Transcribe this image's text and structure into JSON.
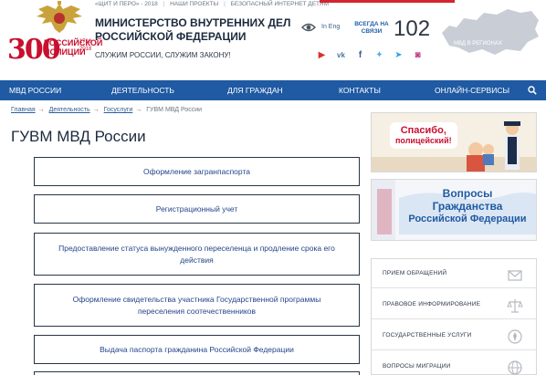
{
  "header": {
    "anniversary_number": "300",
    "anniversary_line1": "РОССИЙСКОЙ",
    "anniversary_line2": "ПОЛИЦИИ",
    "anniversary_years": "1718 2018",
    "top_links": [
      "«ЩИТ И ПЕРО» - 2018",
      "НАШИ ПРОЕКТЫ",
      "БЕЗОПАСНЫЙ ИНТЕРНЕТ ДЕТЯМ"
    ],
    "ministry_title": "МИНИСТЕРСТВО ВНУТРЕННИХ ДЕЛ РОССИЙСКОЙ ФЕДЕРАЦИИ",
    "slogan": "СЛУЖИМ РОССИИ, СЛУЖИМ ЗАКОНУ!",
    "lang_link": "In Eng",
    "hotline_caption": "ВСЕГДА НА СВЯЗИ",
    "hotline_number": "102",
    "regions_label": "МВД В РЕГИОНАХ",
    "social_icons": [
      "youtube-icon",
      "vk-icon",
      "facebook-icon",
      "twitter-icon",
      "telegram-icon",
      "instagram-icon"
    ]
  },
  "nav": {
    "items": [
      "МВД РОССИИ",
      "ДЕЯТЕЛЬНОСТЬ",
      "ДЛЯ ГРАЖДАН",
      "КОНТАКТЫ",
      "ОНЛАЙН-СЕРВИСЫ"
    ]
  },
  "breadcrumb": {
    "items": [
      "Главная",
      "Деятельность",
      "Госуслуги"
    ],
    "current": "ГУВМ МВД России"
  },
  "page_title": "ГУВМ МВД России",
  "services": [
    "Оформление загранпаспорта",
    "Регистрационный учет",
    "Предоставление статуса вынужденного переселенца и продление срока его действия",
    "Оформление свидетельства участника Государственной программы переселения соотечественников",
    "Выдача паспорта гражданина Российской Федерации"
  ],
  "banners": {
    "thanks_line1": "Спасибо,",
    "thanks_line2": "полицейский!",
    "questions_line1": "Вопросы",
    "questions_line2": "Гражданства",
    "questions_line3": "Российской Федерации"
  },
  "sidebar": {
    "items": [
      "ПРИЕМ ОБРАЩЕНИЙ",
      "ПРАВОВОЕ ИНФОРМИРОВАНИЕ",
      "ГОСУДАРСТВЕННЫЕ УСЛУГИ",
      "ВОПРОСЫ МИГРАЦИИ"
    ]
  },
  "colors": {
    "nav_bg": "#1f5aa3",
    "accent_red": "#c8102e",
    "link_blue": "#24458a"
  }
}
